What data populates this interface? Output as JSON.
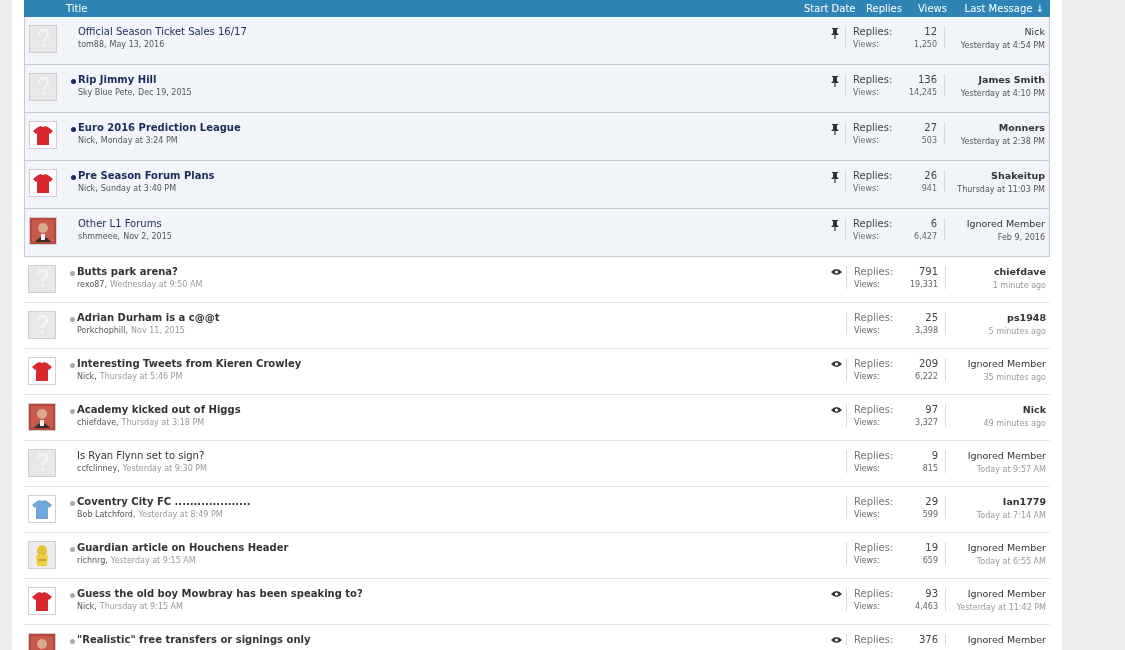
{
  "header": {
    "columns": [
      "Title",
      "Start Date",
      "Replies",
      "Views",
      "Last Message ↓"
    ]
  },
  "threads": [
    {
      "title": "Official Season Ticket Sales 16/17",
      "author": "tom88,",
      "date": "May 13, 2016",
      "avatar": {
        "kind": "placeholder"
      },
      "sticky": true,
      "unread": false,
      "replies_label": "Replies:",
      "replies": "12",
      "views_label": "Views:",
      "views": "1,250",
      "last_user": "Nick",
      "last_user_bold": false,
      "last_time": "Yesterday at 4:54 PM"
    },
    {
      "title": "Rip Jimmy Hill",
      "author": "Sky Blue Pete,",
      "date": "Dec 19, 2015",
      "avatar": {
        "kind": "placeholder"
      },
      "sticky": true,
      "unread": true,
      "replies_label": "Replies:",
      "replies": "136",
      "views_label": "Views:",
      "views": "14,245",
      "last_user": "James Smith",
      "last_user_bold": true,
      "last_time": "Yesterday at 4:10 PM"
    },
    {
      "title": "Euro 2016 Prediction League",
      "author": "Nick,",
      "date": "Monday at 3:24 PM",
      "avatar": {
        "kind": "shirt",
        "color": "#d9282b"
      },
      "sticky": true,
      "unread": true,
      "replies_label": "Replies:",
      "replies": "27",
      "views_label": "Views:",
      "views": "503",
      "last_user": "Monners",
      "last_user_bold": true,
      "last_time": "Yesterday at 2:38 PM"
    },
    {
      "title": "Pre Season Forum Plans",
      "author": "Nick,",
      "date": "Sunday at 3:40 PM",
      "avatar": {
        "kind": "shirt",
        "color": "#d9282b"
      },
      "sticky": true,
      "unread": true,
      "replies_label": "Replies:",
      "replies": "26",
      "views_label": "Views:",
      "views": "941",
      "last_user": "Shakeitup",
      "last_user_bold": true,
      "last_time": "Thursday at 11:03 PM"
    },
    {
      "title": "Other L1 Forums",
      "author": "shmmeee,",
      "date": "Nov 2, 2015",
      "sticky": true,
      "unread": false,
      "replies_label": "Replies:",
      "replies": "6",
      "views_label": "Views:",
      "views": "6,427",
      "last_user": "Ignored Member",
      "last_user_bold": false,
      "last_time": "Feb 9, 2016"
    },
    {
      "title": "Butts park arena?",
      "author": "rexo87,",
      "date": "Wednesday at 9:50 AM",
      "avatar": {
        "kind": "placeholder"
      },
      "sticky": false,
      "unread": true,
      "watched": true,
      "replies_label": "Replies:",
      "replies": "791",
      "views_label": "Views:",
      "views": "19,331",
      "last_user": "chiefdave",
      "last_user_bold": true,
      "last_time": "1 minute ago"
    },
    {
      "title": "Adrian Durham is a c@@t",
      "author": "Porkchophill,",
      "date": "Nov 11, 2015",
      "avatar": {
        "kind": "placeholder"
      },
      "sticky": false,
      "unread": true,
      "watched": false,
      "replies_label": "Replies:",
      "replies": "25",
      "views_label": "Views:",
      "views": "3,398",
      "last_user": "ps1948",
      "last_user_bold": true,
      "last_time": "5 minutes ago"
    },
    {
      "title": "Interesting Tweets from Kieren Crowley",
      "author": "Nick,",
      "date": "Thursday at 5:46 PM",
      "avatar": {
        "kind": "shirt",
        "color": "#d9282b"
      },
      "sticky": false,
      "unread": true,
      "watched": true,
      "replies_label": "Replies:",
      "replies": "209",
      "views_label": "Views:",
      "views": "6,222",
      "last_user": "Ignored Member",
      "last_user_bold": false,
      "last_time": "35 minutes ago"
    },
    {
      "title": "Academy kicked out of Higgs",
      "author": "chiefdave,",
      "date": "Thursday at 3:18 PM",
      "sticky": false,
      "unread": true,
      "watched": true,
      "replies_label": "Replies:",
      "replies": "97",
      "views_label": "Views:",
      "views": "3,327",
      "last_user": "Nick",
      "last_user_bold": true,
      "last_time": "49 minutes ago"
    },
    {
      "title": "Is Ryan Flynn set to sign?",
      "author": "ccfclinney,",
      "date": "Yesterday at 9:30 PM",
      "avatar": {
        "kind": "placeholder"
      },
      "sticky": false,
      "unread": false,
      "watched": false,
      "replies_label": "Replies:",
      "replies": "9",
      "views_label": "Views:",
      "views": "815",
      "last_user": "Ignored Member",
      "last_user_bold": false,
      "last_time": "Today at 9:57 AM"
    },
    {
      "title": "Coventry City FC ....................",
      "author": "Bob Latchford,",
      "date": "Yesterday at 8:49 PM",
      "avatar": {
        "kind": "shirt",
        "color": "#6fa7d9"
      },
      "sticky": false,
      "unread": true,
      "watched": false,
      "replies_label": "Replies:",
      "replies": "29",
      "views_label": "Views:",
      "views": "599",
      "last_user": "Ian1779",
      "last_user_bold": true,
      "last_time": "Today at 7:14 AM"
    },
    {
      "title": "Guardian article on Houchens Header",
      "author": "richnrg,",
      "date": "Yesterday at 9:15 AM",
      "sticky": false,
      "unread": true,
      "watched": false,
      "replies_label": "Replies:",
      "replies": "19",
      "views_label": "Views:",
      "views": "659",
      "last_user": "Ignored Member",
      "last_user_bold": false,
      "last_time": "Today at 6:55 AM"
    },
    {
      "title": "Guess the old boy Mowbray has been speaking to?",
      "author": "Nick,",
      "date": "Thursday at 9:15 AM",
      "avatar": {
        "kind": "shirt",
        "color": "#d9282b"
      },
      "sticky": false,
      "unread": true,
      "watched": true,
      "replies_label": "Replies:",
      "replies": "93",
      "views_label": "Views:",
      "views": "4,463",
      "last_user": "Ignored Member",
      "last_user_bold": false,
      "last_time": "Yesterday at 11:42 PM"
    },
    {
      "title": "\"Realistic\" free transfers or signings only",
      "sticky": false,
      "unread": true,
      "watched": true,
      "replies_label": "Replies:",
      "replies": "376",
      "last_user": "Ignored Member",
      "last_user_bold": false
    }
  ]
}
